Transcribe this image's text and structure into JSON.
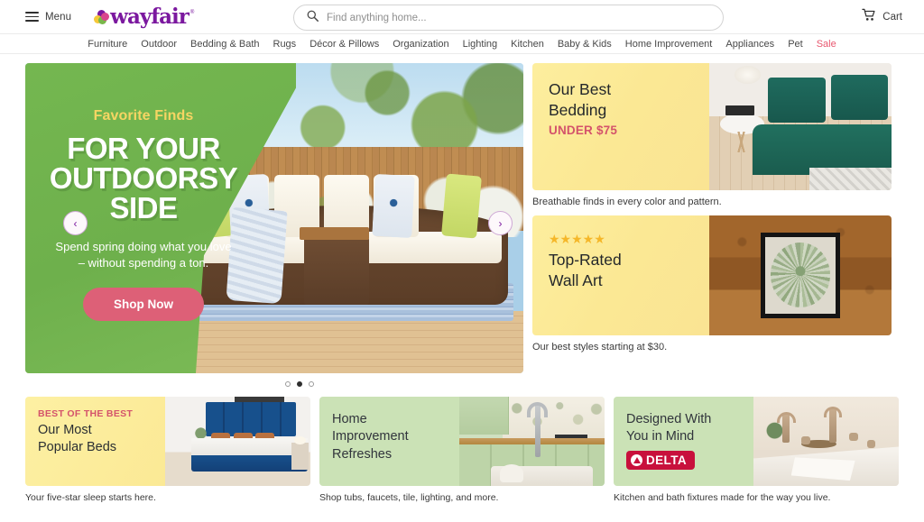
{
  "header": {
    "menu_label": "Menu",
    "logo_text": "wayfair",
    "logo_tm": "®",
    "search_placeholder": "Find anything home...",
    "search_value": "",
    "cart_label": "Cart",
    "icons": {
      "menu": "hamburger-icon",
      "search": "search-icon",
      "cart": "cart-icon",
      "logo": "wayfair-clover-logo"
    }
  },
  "nav": {
    "items": [
      {
        "label": "Furniture",
        "sale": false
      },
      {
        "label": "Outdoor",
        "sale": false
      },
      {
        "label": "Bedding & Bath",
        "sale": false
      },
      {
        "label": "Rugs",
        "sale": false
      },
      {
        "label": "Décor & Pillows",
        "sale": false
      },
      {
        "label": "Organization",
        "sale": false
      },
      {
        "label": "Lighting",
        "sale": false
      },
      {
        "label": "Kitchen",
        "sale": false
      },
      {
        "label": "Baby & Kids",
        "sale": false
      },
      {
        "label": "Home Improvement",
        "sale": false
      },
      {
        "label": "Appliances",
        "sale": false
      },
      {
        "label": "Pet",
        "sale": false
      },
      {
        "label": "Sale",
        "sale": true
      }
    ],
    "sale_color": "#e8576f"
  },
  "hero": {
    "eyebrow": "Favorite Finds",
    "title_line1": "FOR YOUR",
    "title_line2": "OUTDOORSY",
    "title_line3": "SIDE",
    "subtitle": "Spend spring doing what you love – without spending a ton.",
    "cta_label": "Shop Now",
    "prev_arrow": "‹",
    "next_arrow": "›",
    "panel_color": "#74b750",
    "eyebrow_color": "#f6d563",
    "cta_color": "#dd6077",
    "dots": [
      {
        "active": false
      },
      {
        "active": true
      },
      {
        "active": false
      }
    ]
  },
  "promos": [
    {
      "heading_line1": "Our Best",
      "heading_line2": "Bedding",
      "kicker": "UNDER $75",
      "caption": "Breathable finds in every color and pattern.",
      "stars": "",
      "bg_color": "#fbe894",
      "kicker_color": "#d4536b"
    },
    {
      "heading_line1": "Top-Rated",
      "heading_line2": "Wall Art",
      "kicker": "",
      "caption": "Our best styles starting at $30.",
      "stars": "★★★★★",
      "bg_color": "#fbe894",
      "stars_color": "#f5b729"
    }
  ],
  "tiles": [
    {
      "eyebrow": "BEST OF THE BEST",
      "heading_line1": "Our Most",
      "heading_line2": "Popular Beds",
      "heading_line3": "",
      "caption": "Your five-star sleep starts here.",
      "bg": "yellow",
      "brand": ""
    },
    {
      "eyebrow": "",
      "heading_line1": "Home",
      "heading_line2": "Improvement",
      "heading_line3": "Refreshes",
      "caption": "Shop tubs, faucets, tile, lighting, and more.",
      "bg": "green",
      "brand": ""
    },
    {
      "eyebrow": "",
      "heading_line1": "Designed With",
      "heading_line2": "You in Mind",
      "heading_line3": "",
      "caption": "Kitchen and bath fixtures made for the way you live.",
      "bg": "green",
      "brand": "DELTA",
      "brand_color": "#c8103c"
    }
  ]
}
